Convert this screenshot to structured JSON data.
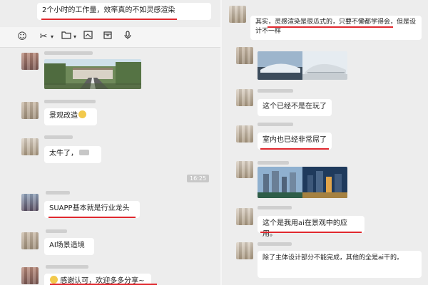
{
  "left": {
    "top_message": "2个小时的工作量，效率真的不如灵感渲染",
    "toolbar_icons": [
      "emoji-icon",
      "scissors-icon",
      "folder-icon",
      "screenshot-icon",
      "box-icon",
      "microphone-icon"
    ],
    "messages": [
      {
        "text": "景观改造"
      },
      {
        "text": "太牛了，"
      },
      {
        "text": "SUAPP基本就是行业龙头"
      },
      {
        "text": "AI场景造境"
      },
      {
        "text": "感谢认可，欢迎多多分享~"
      }
    ],
    "timestamp": "16:25"
  },
  "right": {
    "top_message": "其实，灵感渲染是很瓜式的，只要不懒都学得会，但是设计不一样",
    "messages": [
      {
        "text": "这个已经不是在玩了"
      },
      {
        "text": "室内也已经非常屌了"
      },
      {
        "text": "这个是我用ai在景观中的应用。"
      },
      {
        "text": "除了主体设计部分不能完成，其他的全是ai干的。"
      }
    ]
  },
  "colors": {
    "highlight": "#e0282e",
    "bubble": "#ffffff",
    "background": "#ededed"
  }
}
